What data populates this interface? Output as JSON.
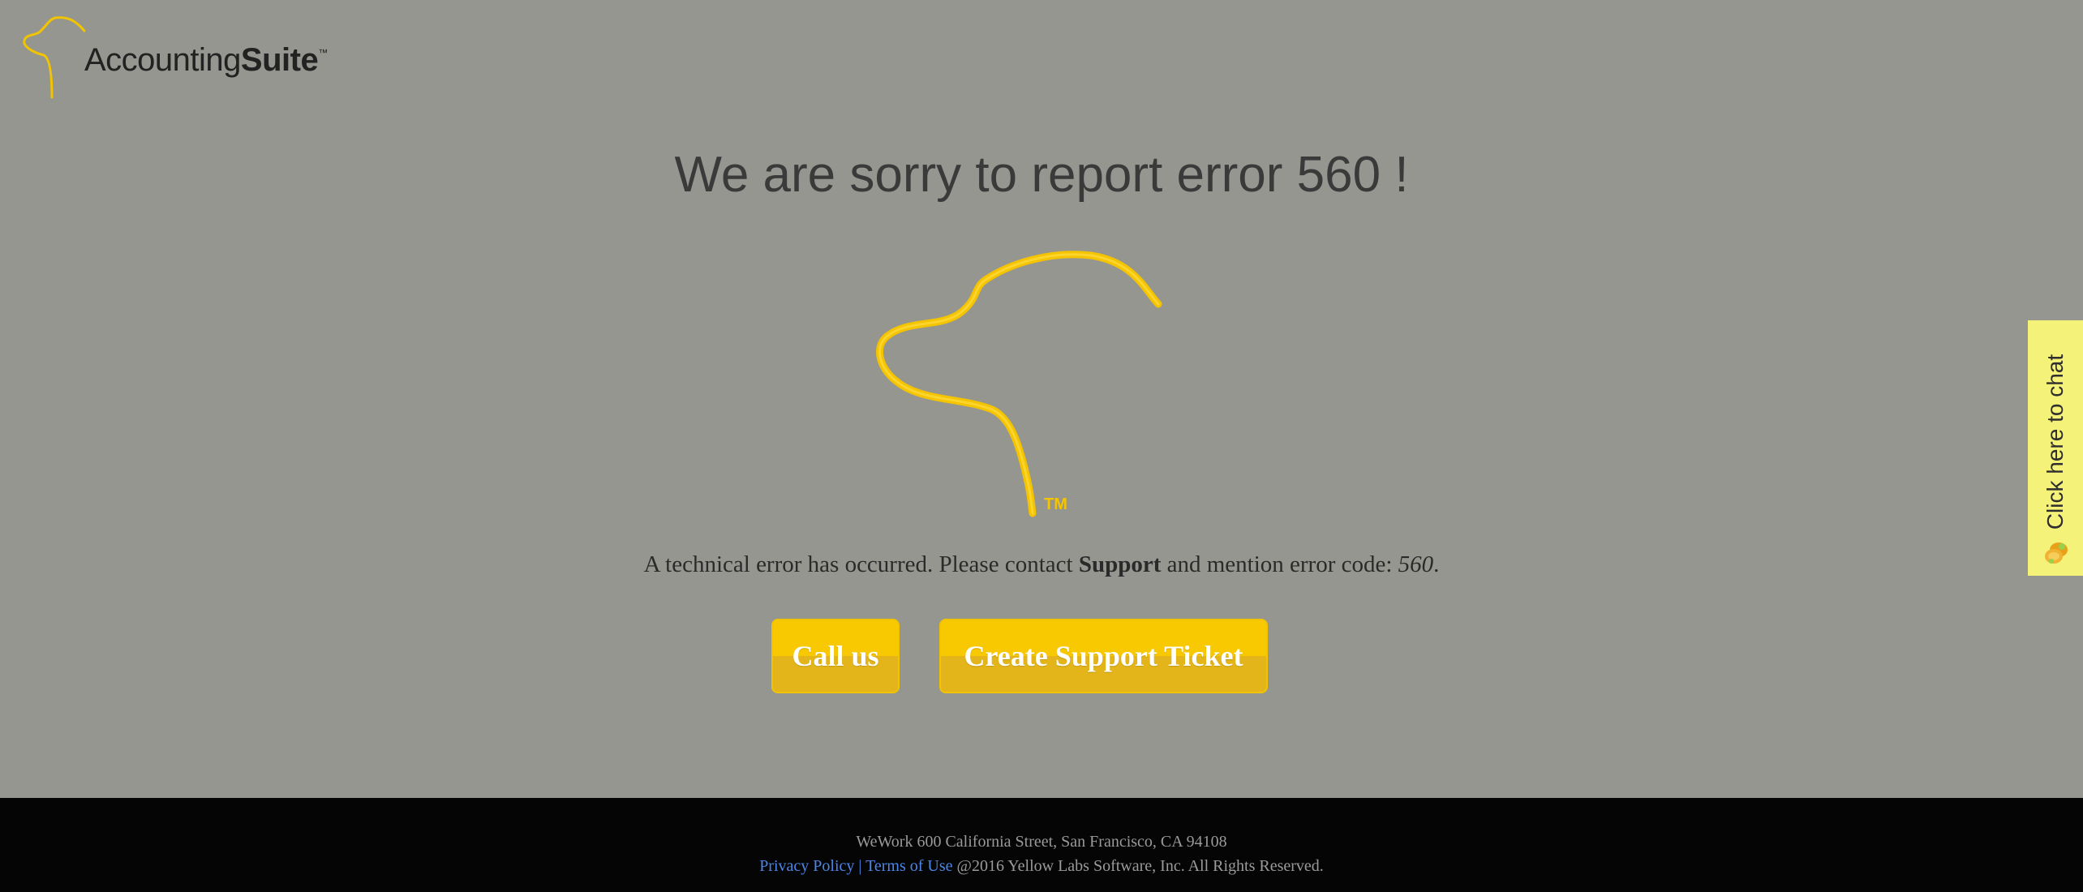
{
  "logo": {
    "name_regular": "Accounting",
    "name_bold": "Suite",
    "trademark": "™"
  },
  "error": {
    "title": "We are sorry to report error 560 !",
    "message_before": "A technical error has occurred. Please contact ",
    "message_support": "Support",
    "message_middle": " and mention error code: ",
    "error_code": "560",
    "message_end": ".",
    "mascot_trademark": "TM"
  },
  "buttons": {
    "call_us": "Call us",
    "create_ticket": "Create Support Ticket"
  },
  "chat": {
    "label": "Click here to chat"
  },
  "footer": {
    "address": "WeWork 600 California Street, San Francisco, CA 94108",
    "privacy": "Privacy Policy",
    "separator": " | ",
    "terms": "Terms of Use",
    "copyright": " @2016 Yellow Labs Software, Inc. All Rights Reserved."
  },
  "colors": {
    "background": "#969690",
    "accent": "#f8c800",
    "chat_tab": "#f5f27a",
    "footer_bg": "#050505",
    "link": "#4a86e8"
  }
}
